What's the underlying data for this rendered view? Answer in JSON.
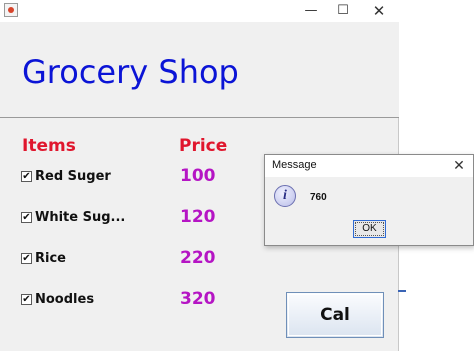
{
  "window": {
    "minimize_glyph": "—",
    "maximize_glyph": "☐",
    "close_glyph": "✕"
  },
  "header": {
    "title": "Grocery Shop"
  },
  "columns": {
    "items": "Items",
    "price": "Price"
  },
  "items": [
    {
      "label": "Red Suger",
      "price": "100",
      "checked": true,
      "check_glyph": "✔"
    },
    {
      "label": "White Sug...",
      "price": "120",
      "checked": true,
      "check_glyph": "✔"
    },
    {
      "label": "Rice",
      "price": "220",
      "checked": true,
      "check_glyph": "✔"
    },
    {
      "label": "Noodles",
      "price": "320",
      "checked": true,
      "check_glyph": "✔"
    }
  ],
  "actions": {
    "calculate_label": "Cal"
  },
  "dialog": {
    "title": "Message",
    "close_glyph": "✕",
    "icon": "info-icon",
    "icon_glyph": "i",
    "message": "760",
    "ok_label": "OK"
  },
  "colors": {
    "title": "#0b14d6",
    "column_header": "#e0162d",
    "price": "#b515c4"
  }
}
